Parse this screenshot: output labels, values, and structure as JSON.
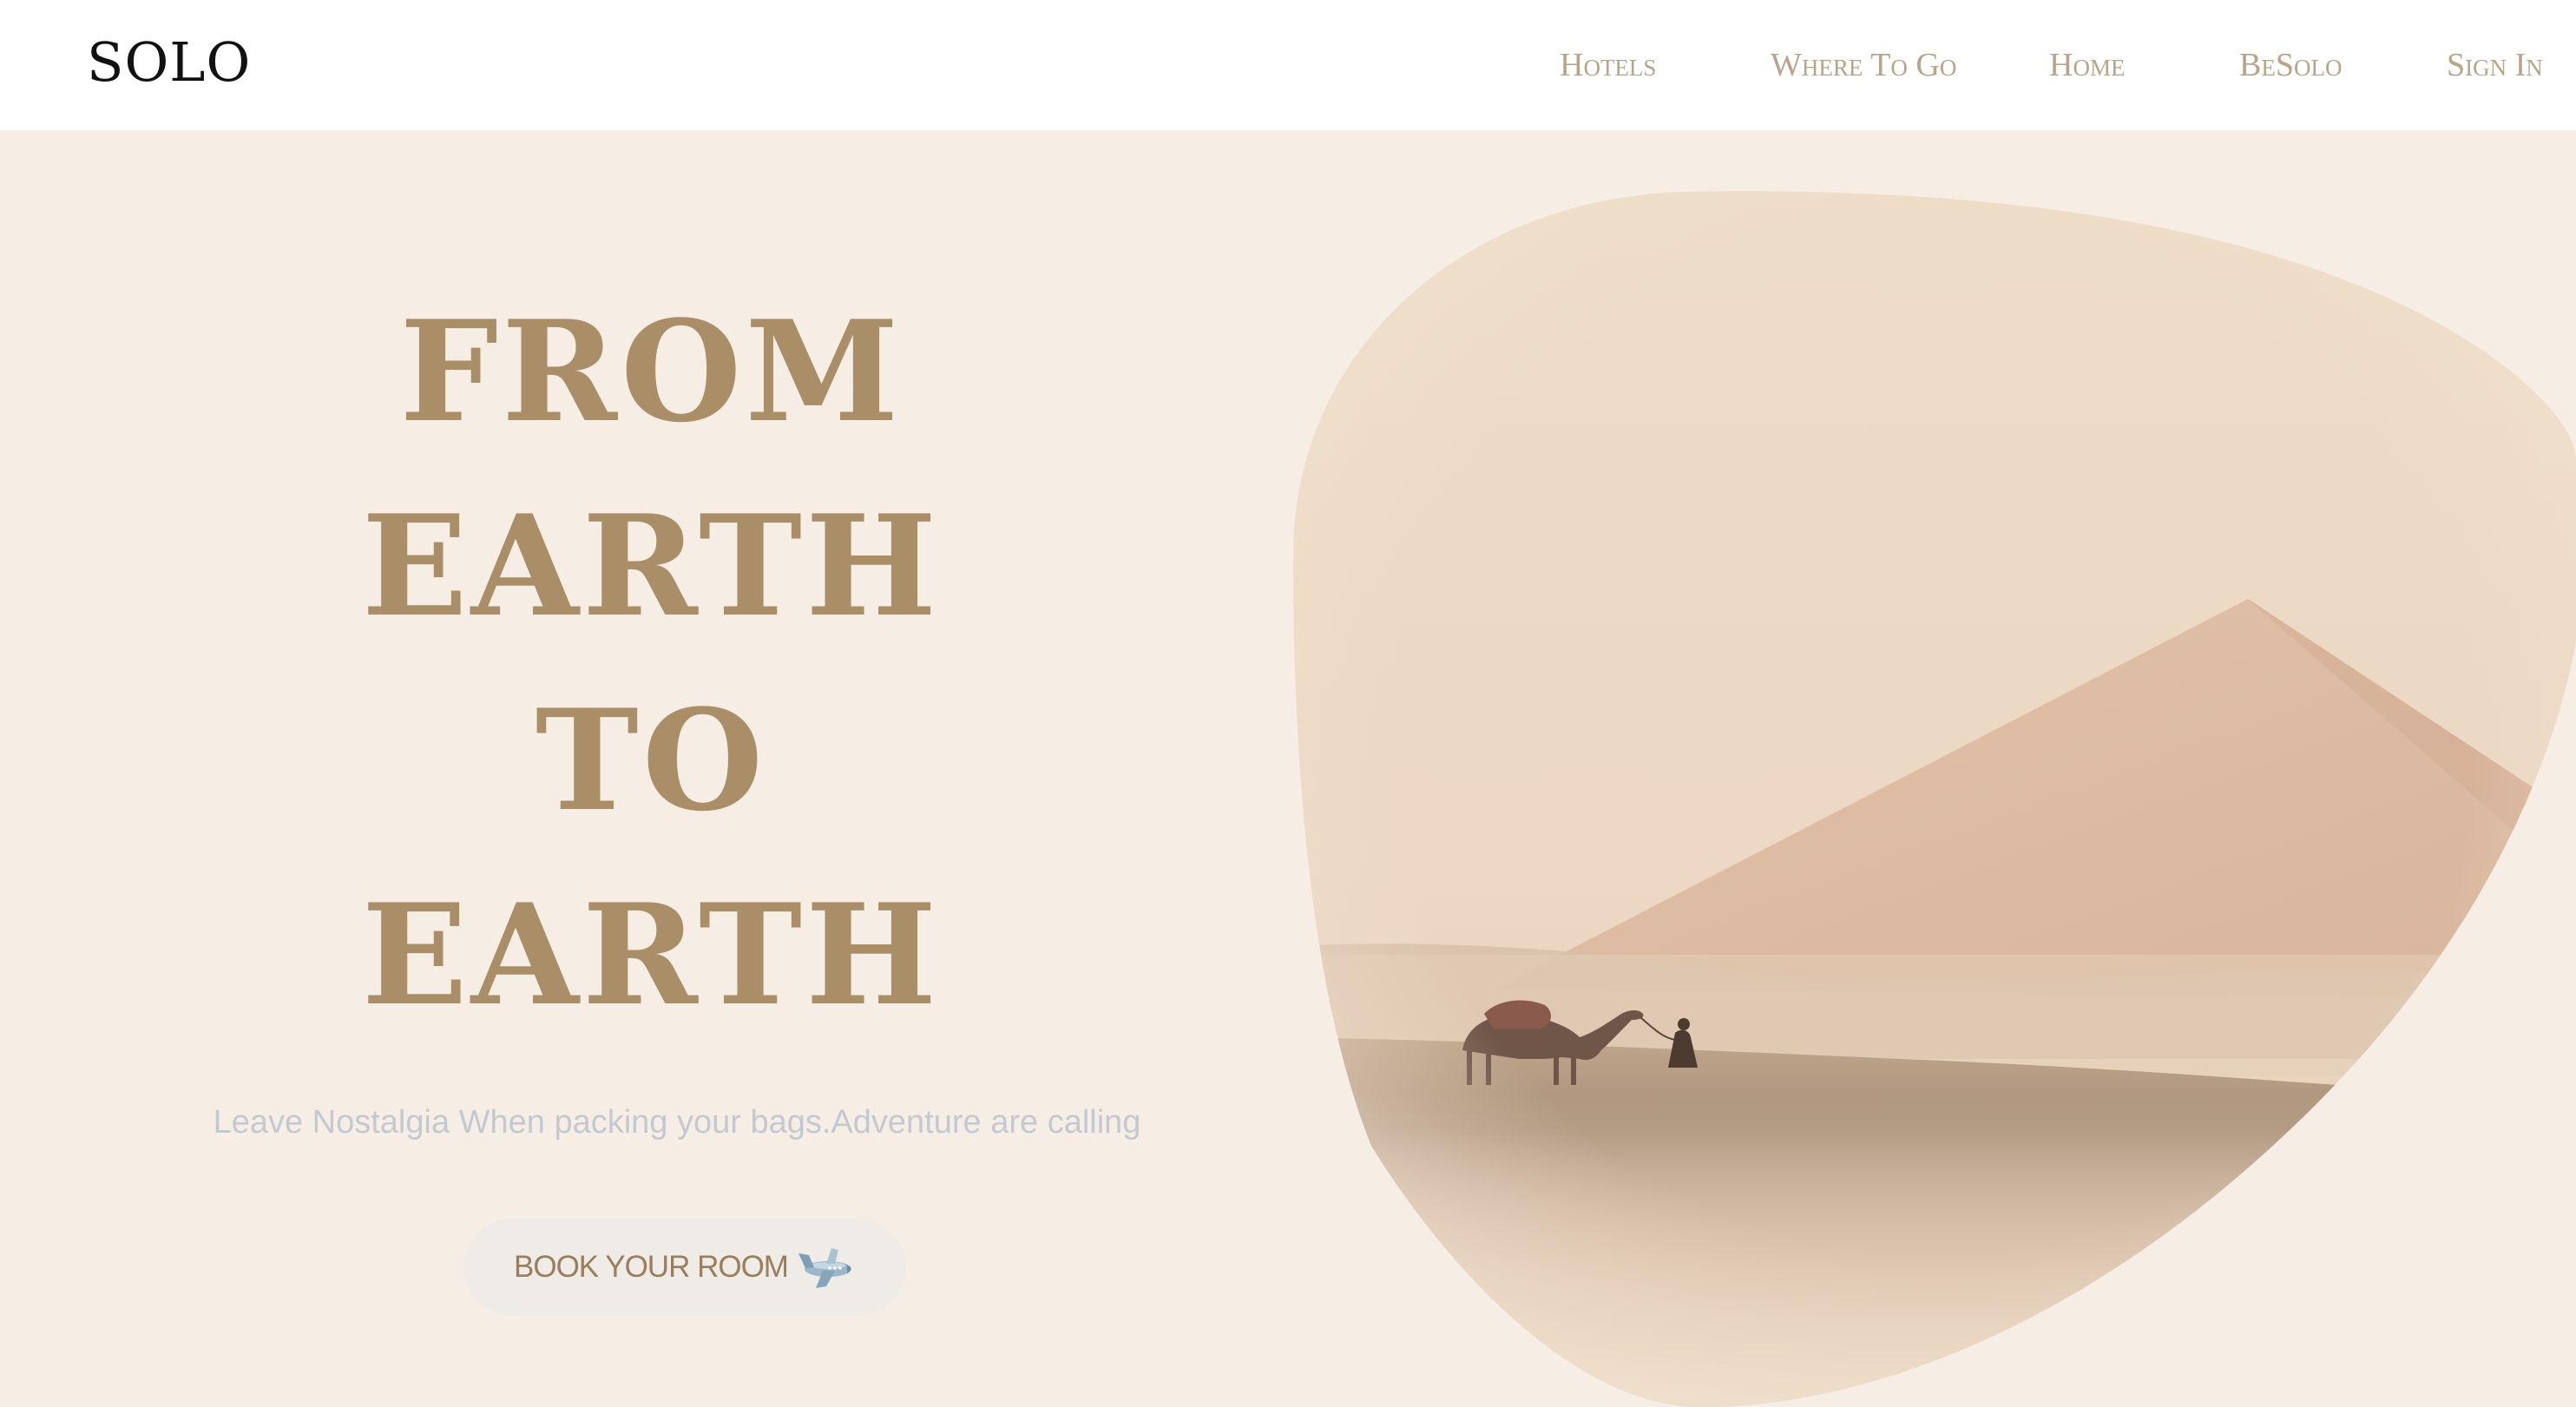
{
  "brand": {
    "logo": "SOLO"
  },
  "nav": {
    "items": [
      {
        "label": "Hotels"
      },
      {
        "label": "Where To Go"
      },
      {
        "label": "Home"
      },
      {
        "label": "BeSolo"
      },
      {
        "label": "Sign In"
      }
    ]
  },
  "hero": {
    "headline": [
      "FROM",
      "EARTH",
      "TO",
      "EARTH"
    ],
    "tagline": "Leave Nostalgia When packing your bags.Adventure are calling",
    "cta": {
      "label": "BOOK YOUR ROOM",
      "icon": "airplane-icon"
    },
    "image": {
      "subject": "desert-pyramid-camel-icon"
    }
  },
  "colors": {
    "page_background": "#f6eee5",
    "nav_background": "#ffffff",
    "headline": "#a98e68",
    "nav_link": "#b7a58b",
    "tagline": "#c3c9d2",
    "cta_background": "#efebe6",
    "cta_text": "#9a7e5e"
  }
}
